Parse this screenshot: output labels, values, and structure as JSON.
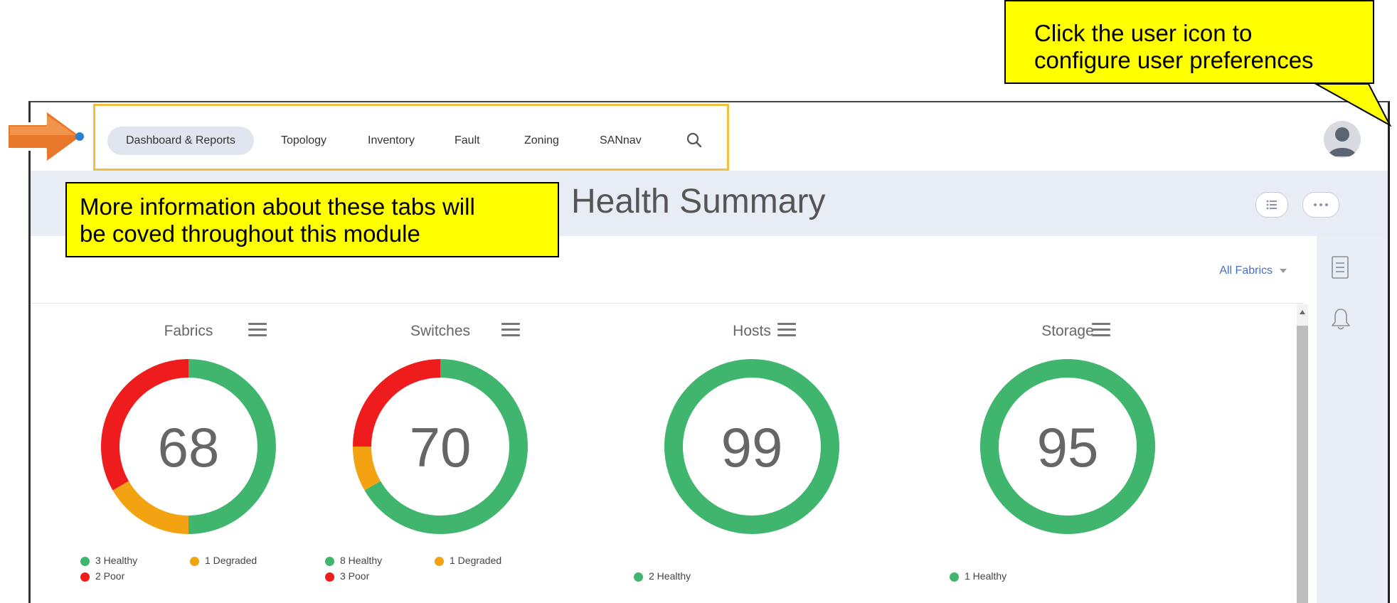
{
  "callouts": {
    "top": [
      "Click the user icon to",
      "configure user preferences"
    ],
    "left": [
      "More information about these tabs will",
      "be coved throughout this module"
    ]
  },
  "tabs": [
    {
      "label": "Dashboard & Reports",
      "active": true
    },
    {
      "label": "Topology"
    },
    {
      "label": "Inventory"
    },
    {
      "label": "Fault"
    },
    {
      "label": "Zoning"
    },
    {
      "label": "SANnav"
    }
  ],
  "page": {
    "title": "Health Summary"
  },
  "filter": {
    "label": "All Fabrics"
  },
  "colors": {
    "healthy": "#3fb56e",
    "degraded": "#f3a312",
    "poor": "#ee1c1c",
    "highlight": "#ffff00"
  },
  "cards": [
    {
      "title": "Fabrics",
      "score": "68",
      "segments": [
        {
          "status": "healthy",
          "count": 3
        },
        {
          "status": "degraded",
          "count": 1
        },
        {
          "status": "poor",
          "count": 2
        }
      ],
      "legend": [
        {
          "label": "3 Healthy",
          "status": "healthy"
        },
        {
          "label": "1 Degraded",
          "status": "degraded"
        },
        {
          "label": "2 Poor",
          "status": "poor"
        }
      ]
    },
    {
      "title": "Switches",
      "score": "70",
      "segments": [
        {
          "status": "healthy",
          "count": 8
        },
        {
          "status": "degraded",
          "count": 1
        },
        {
          "status": "poor",
          "count": 3
        }
      ],
      "legend": [
        {
          "label": "8 Healthy",
          "status": "healthy"
        },
        {
          "label": "1 Degraded",
          "status": "degraded"
        },
        {
          "label": "3 Poor",
          "status": "poor"
        }
      ]
    },
    {
      "title": "Hosts",
      "score": "99",
      "segments": [
        {
          "status": "healthy",
          "count": 2
        }
      ],
      "legend": [
        {
          "label": "2 Healthy",
          "status": "healthy"
        }
      ]
    },
    {
      "title": "Storage",
      "score": "95",
      "segments": [
        {
          "status": "healthy",
          "count": 1
        }
      ],
      "legend": [
        {
          "label": "1 Healthy",
          "status": "healthy"
        }
      ]
    }
  ]
}
